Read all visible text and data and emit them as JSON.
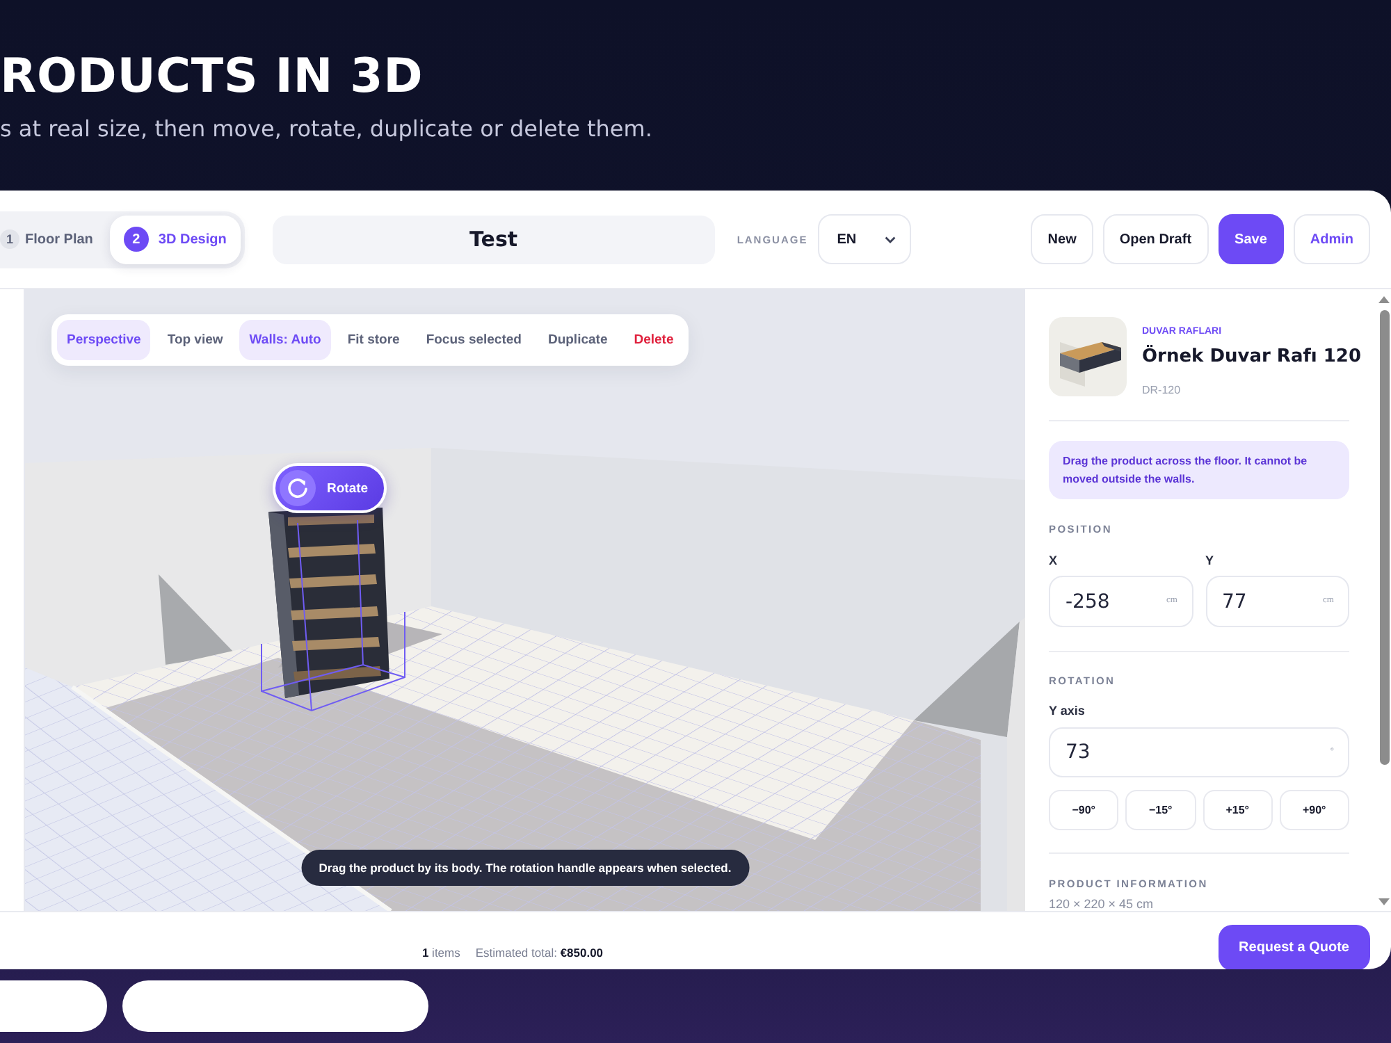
{
  "hero": {
    "title": "RODUCTS IN 3D",
    "subtitle": "s at real size, then move, rotate, duplicate or delete them."
  },
  "app": {
    "steps": [
      {
        "number": "1",
        "label": "Floor Plan",
        "selected": false
      },
      {
        "number": "2",
        "label": "3D Design",
        "selected": true
      }
    ],
    "project_name": "Test",
    "language": {
      "label": "LANGUAGE",
      "value": "EN"
    },
    "actions": [
      {
        "label": "New",
        "kind": "outline"
      },
      {
        "label": "Open Draft",
        "kind": "outline"
      },
      {
        "label": "Save",
        "kind": "primary"
      },
      {
        "label": "Admin",
        "kind": "link"
      }
    ],
    "view_toolbar": [
      {
        "label": "Perspective",
        "selected": true,
        "kind": "normal"
      },
      {
        "label": "Top view",
        "selected": false,
        "kind": "normal"
      },
      {
        "label": "Walls: Auto",
        "selected": true,
        "kind": "normal"
      },
      {
        "label": "Fit store",
        "selected": false,
        "kind": "normal"
      },
      {
        "label": "Focus selected",
        "selected": false,
        "kind": "normal"
      },
      {
        "label": "Duplicate",
        "selected": false,
        "kind": "normal"
      },
      {
        "label": "Delete",
        "selected": false,
        "kind": "danger"
      }
    ],
    "rotate_handle": {
      "label": "Rotate"
    },
    "hint": "Drag the product by its body. The rotation handle appears when selected.",
    "inspector": {
      "category": "DUVAR RAFLARI",
      "name": "Örnek Duvar Rafı 120",
      "code": "DR-120",
      "notice": "Drag the product across the floor. It cannot be moved outside the walls.",
      "position": {
        "title": "POSITION",
        "fields": [
          {
            "label": "X",
            "value": "-258",
            "unit": "cm"
          },
          {
            "label": "Y",
            "value": "77",
            "unit": "cm"
          }
        ]
      },
      "rotation": {
        "title": "ROTATION",
        "label": "Y axis",
        "value": "73",
        "unit": "°",
        "steps": [
          "−90°",
          "−15°",
          "+15°",
          "+90°"
        ]
      },
      "info": {
        "title": "PRODUCT INFORMATION",
        "dimensions": "120 × 220 × 45 cm"
      }
    },
    "footer": {
      "items": "**1** items",
      "total": "Estimated total: **€850.00**",
      "button": "Request a Quote"
    }
  }
}
